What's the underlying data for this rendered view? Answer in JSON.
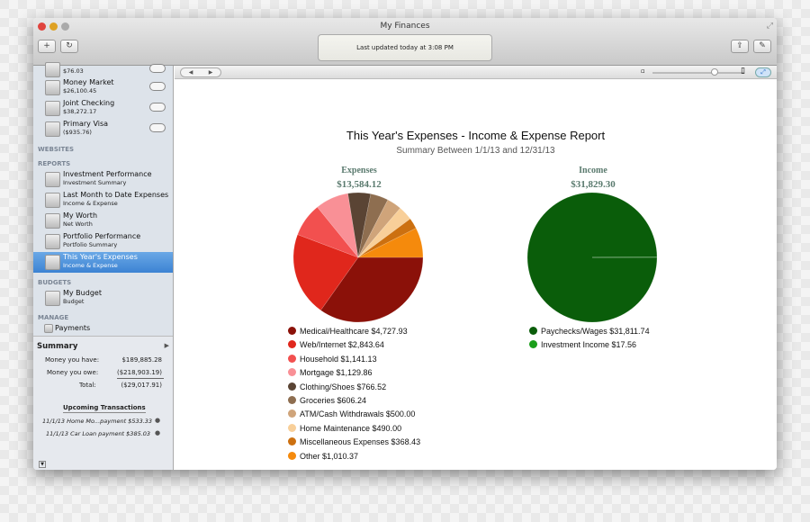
{
  "window": {
    "title": "My Finances",
    "status": "Last updated today at 3:08 PM",
    "add_label": "+",
    "refresh_label": "↻"
  },
  "sidebar": {
    "accounts": [
      {
        "name": "",
        "balance": "$76.03"
      },
      {
        "name": "Money Market",
        "balance": "$26,100.45"
      },
      {
        "name": "Joint Checking",
        "balance": "$38,272.17"
      },
      {
        "name": "Primary Visa",
        "balance": "($935.76)"
      }
    ],
    "websites_header": "WEBSITES",
    "reports_header": "REPORTS",
    "reports": [
      {
        "name": "Investment Performance",
        "type": "Investment Summary"
      },
      {
        "name": "Last Month to Date Expenses",
        "type": "Income & Expense"
      },
      {
        "name": "My Worth",
        "type": "Net Worth"
      },
      {
        "name": "Portfolio Performance",
        "type": "Portfolio Summary"
      },
      {
        "name": "This Year's Expenses",
        "type": "Income & Expense",
        "selected": true
      }
    ],
    "budgets_header": "BUDGETS",
    "budgets": [
      {
        "name": "My Budget",
        "type": "Budget"
      }
    ],
    "manage_header": "MANAGE",
    "manage": [
      {
        "name": "Payments"
      }
    ]
  },
  "summary": {
    "title": "Summary",
    "have_label": "Money you have:",
    "have": "$189,885.28",
    "owe_label": "Money you owe:",
    "owe": "($218,903.19)",
    "total_label": "Total:",
    "total": "($29,017.91)",
    "upcoming_title": "Upcoming Transactions",
    "upcoming": [
      "11/1/13 Home Mo...payment $533.33",
      "11/1/13 Car Loan payment $385.03"
    ]
  },
  "report": {
    "title": "This Year's Expenses - Income & Expense Report",
    "subtitle": "Summary Between 1/1/13 and 12/31/13"
  },
  "chart_data": [
    {
      "type": "pie",
      "title": "Expenses",
      "total": "$13,584.12",
      "start": "3 o'clock, clockwise",
      "slices": [
        {
          "label": "Medical/Healthcare $4,727.93",
          "value": 4727.93,
          "color": "#8b1109"
        },
        {
          "label": "Web/Internet $2,843.64",
          "value": 2843.64,
          "color": "#e0271c"
        },
        {
          "label": "Household $1,141.13",
          "value": 1141.13,
          "color": "#f2504f"
        },
        {
          "label": "Mortgage $1,129.86",
          "value": 1129.86,
          "color": "#f99096"
        },
        {
          "label": "Clothing/Shoes $766.52",
          "value": 766.52,
          "color": "#5a4434"
        },
        {
          "label": "Groceries $606.24",
          "value": 606.24,
          "color": "#8e6e50"
        },
        {
          "label": "ATM/Cash Withdrawals $500.00",
          "value": 500.0,
          "color": "#cfa47a"
        },
        {
          "label": "Home Maintenance $490.00",
          "value": 490.0,
          "color": "#f8cf99"
        },
        {
          "label": "Miscellaneous Expenses $368.43",
          "value": 368.43,
          "color": "#cc7010"
        },
        {
          "label": "Other $1,010.37",
          "value": 1010.37,
          "color": "#f58a0c"
        }
      ]
    },
    {
      "type": "pie",
      "title": "Income",
      "total": "$31,829.30",
      "start": "3 o'clock, clockwise",
      "slices": [
        {
          "label": "Paychecks/Wages $31,811.74",
          "value": 31811.74,
          "color": "#0a5d0a"
        },
        {
          "label": "Investment Income $17.56",
          "value": 17.56,
          "color": "#1a9e1a"
        }
      ]
    }
  ]
}
